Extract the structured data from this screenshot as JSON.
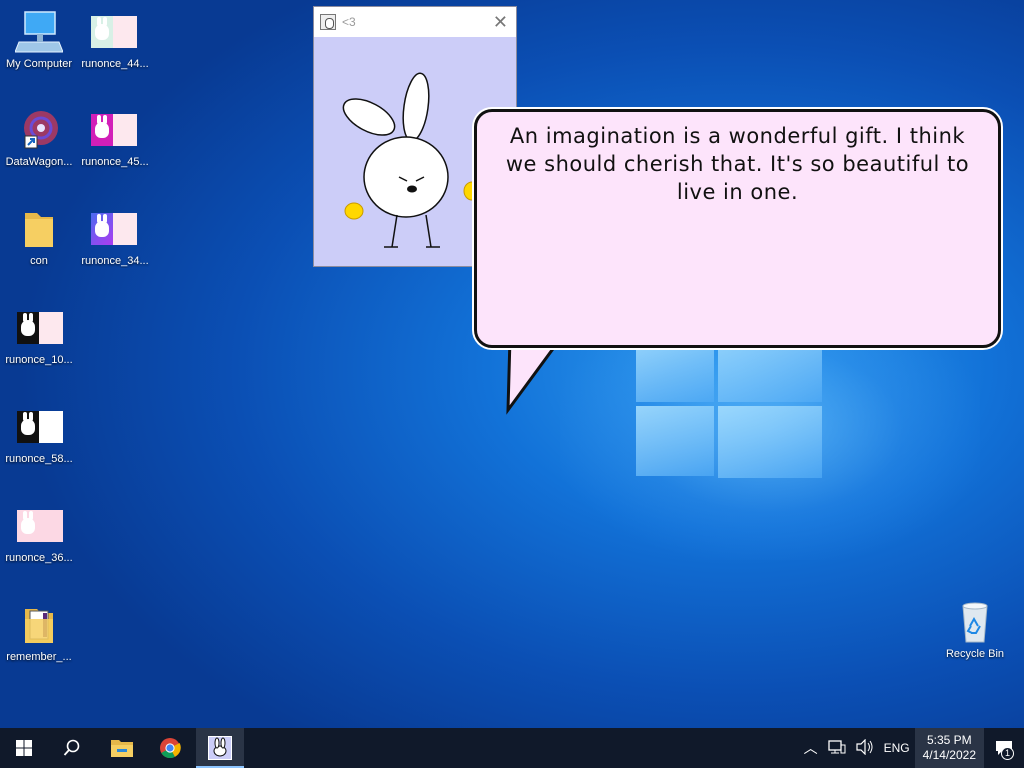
{
  "desktop_icons": [
    {
      "label": "My Computer",
      "icon": "computer-icon"
    },
    {
      "label": "runonce_44...",
      "icon": "image-file-icon"
    },
    {
      "label": "DataWagon...",
      "icon": "datawagon-shortcut-icon"
    },
    {
      "label": "runonce_45...",
      "icon": "image-file-icon"
    },
    {
      "label": "con",
      "icon": "folder-icon"
    },
    {
      "label": "runonce_34...",
      "icon": "image-file-icon"
    },
    {
      "label": "runonce_10...",
      "icon": "image-file-icon"
    },
    {
      "label": "runonce_58...",
      "icon": "image-file-icon"
    },
    {
      "label": "runonce_36...",
      "icon": "image-file-icon"
    },
    {
      "label": "remember_...",
      "icon": "folder-icon"
    },
    {
      "label": "Recycle Bin",
      "icon": "recycle-bin-icon"
    }
  ],
  "pet_window": {
    "title": "<3",
    "close_glyph": "✕"
  },
  "speech_bubble": {
    "text": "An imagination is a wonderful gift. I think we should cherish that. It's so beautiful to live in one."
  },
  "taskbar": {
    "tray": {
      "language": "ENG",
      "time": "5:35 PM",
      "date": "4/14/2022",
      "notification_count": "1"
    }
  },
  "colors": {
    "taskbar": "#10192a",
    "bubble_fill": "#fde4fb",
    "pet_window_bg": "#cccdf8"
  }
}
